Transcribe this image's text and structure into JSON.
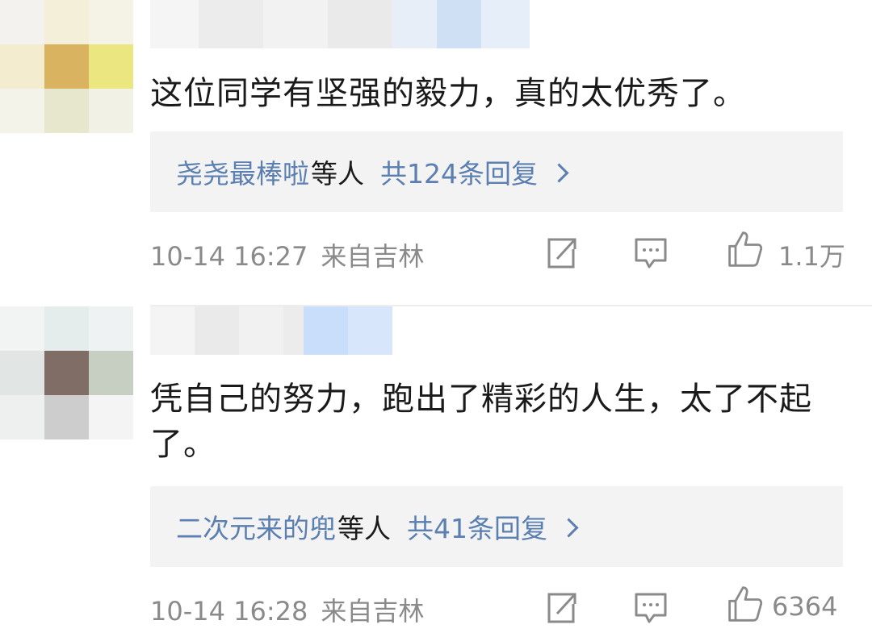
{
  "comments": [
    {
      "text": "这位同学有坚强的毅力，真的太优秀了。",
      "reply_names": "尧尧最棒啦",
      "reply_suffix": "等人",
      "reply_count": "共124条回复",
      "time": "10-14 16:27",
      "source": "来自吉林",
      "likes": "1.1万"
    },
    {
      "text": "凭自己的努力，跑出了精彩的人生，太了不起了。",
      "reply_names": "二次元来的兜",
      "reply_suffix": "等人",
      "reply_count": "共41条回复",
      "time": "10-14 16:28",
      "source": "来自吉林",
      "likes": "6364"
    }
  ],
  "icons": {
    "share": "share-icon",
    "comment": "comment-icon",
    "like": "thumbs-up-icon"
  },
  "colors": {
    "link": "#5a7fb0",
    "meta": "#8a8a8a",
    "reply_bg": "#f3f3f3"
  }
}
